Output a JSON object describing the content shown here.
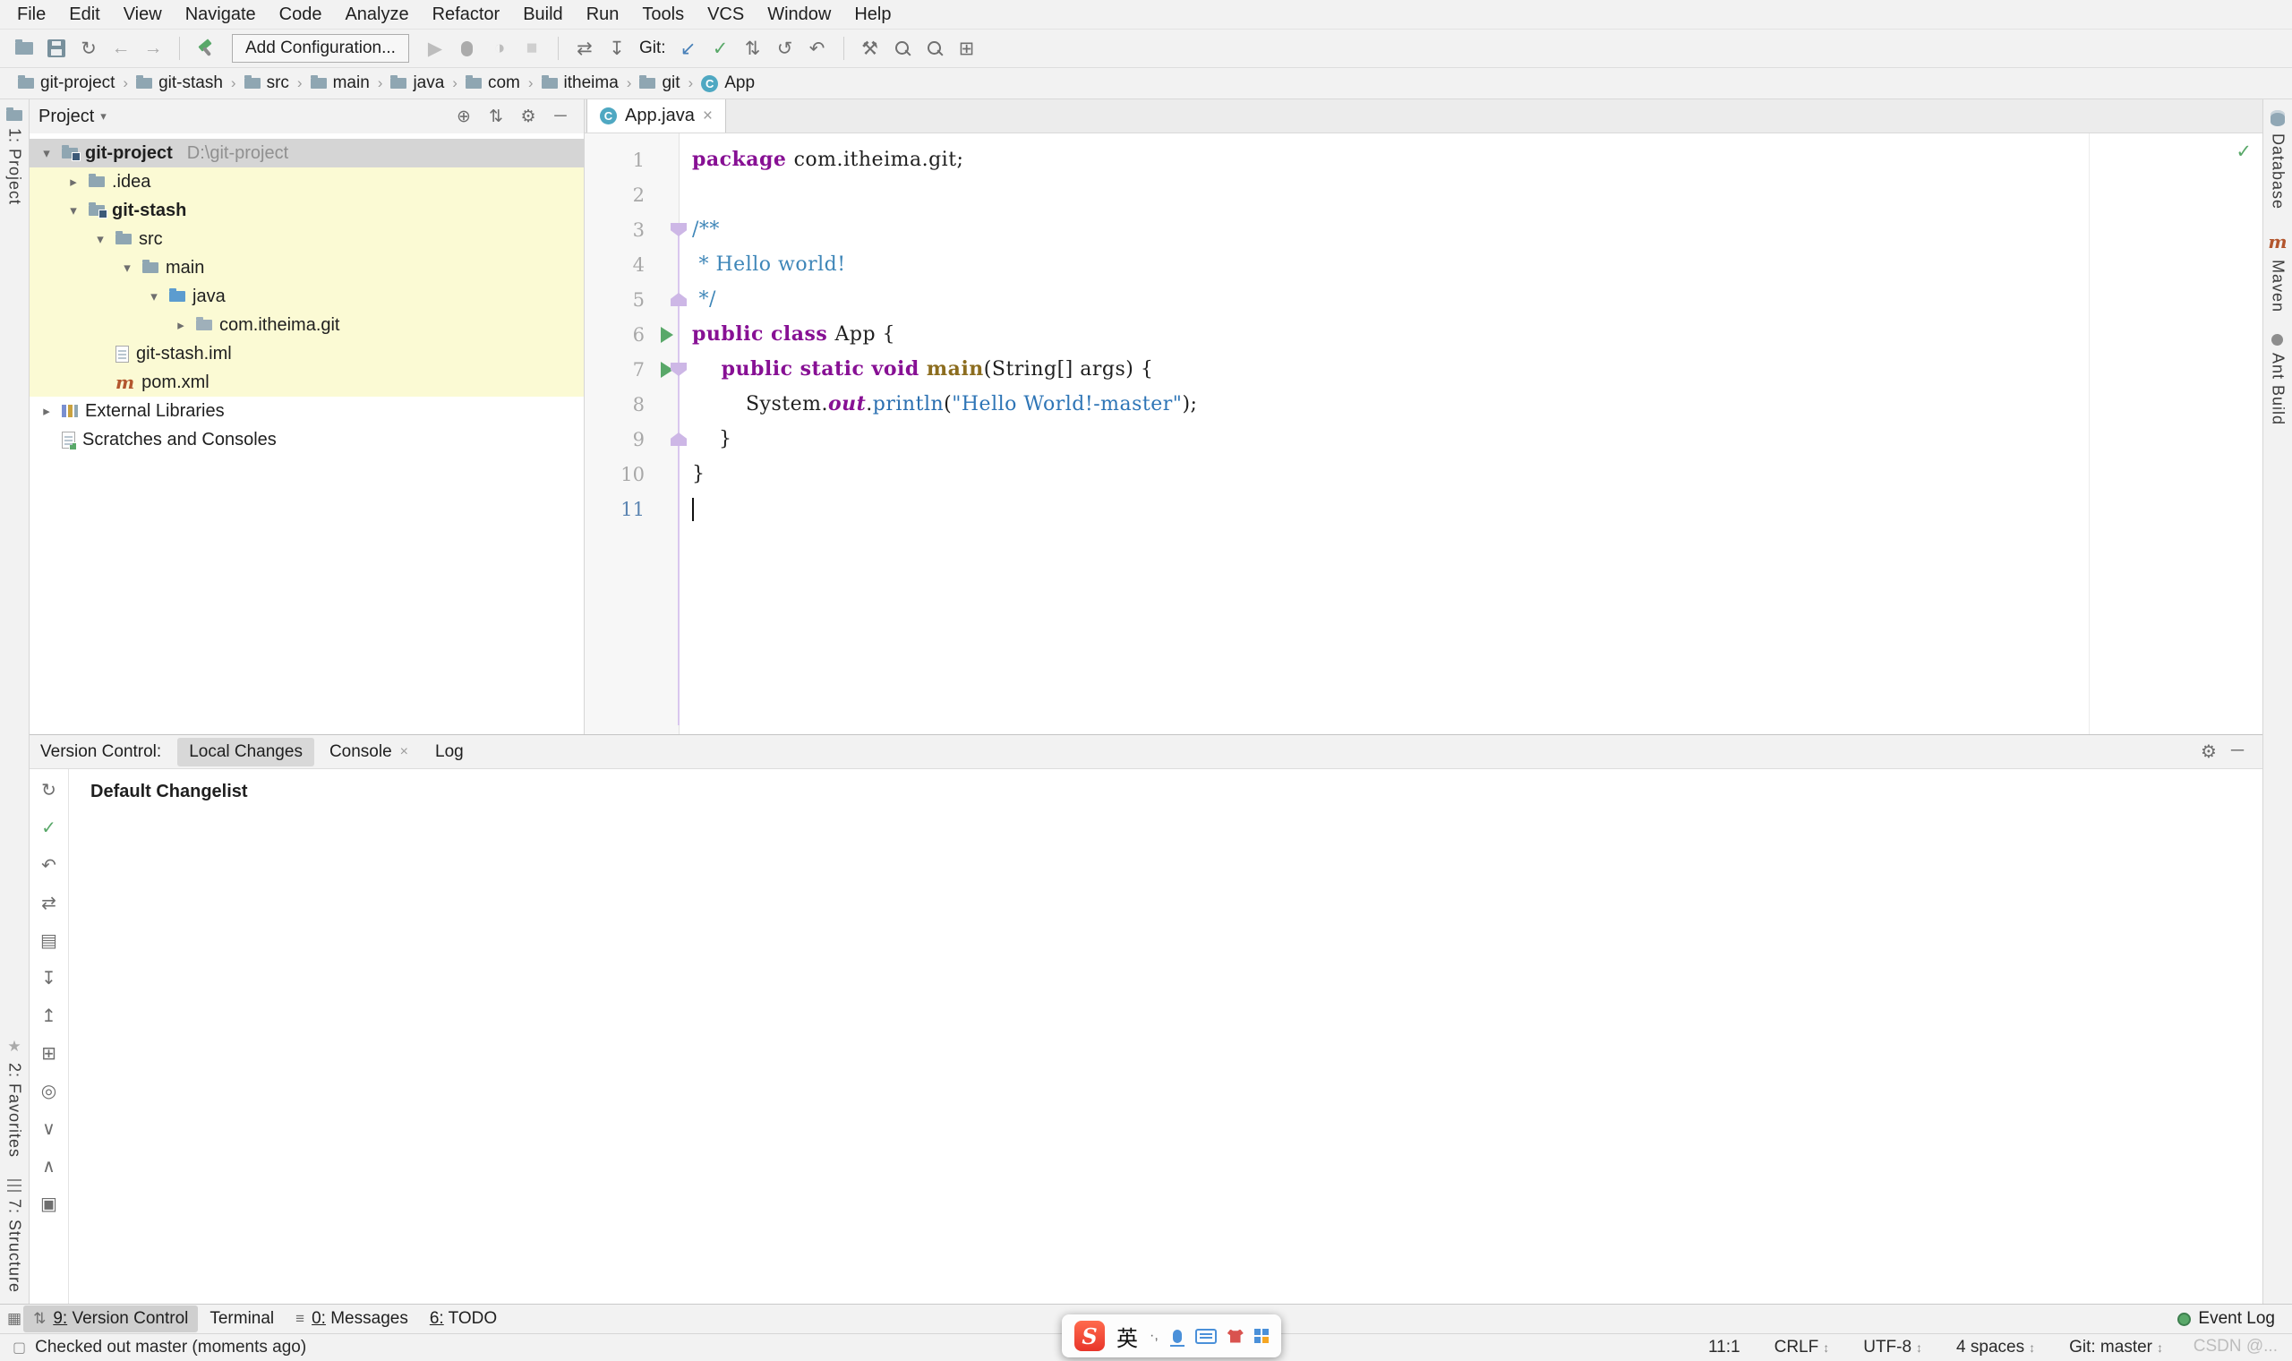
{
  "menubar": {
    "items": [
      "File",
      "Edit",
      "View",
      "Navigate",
      "Code",
      "Analyze",
      "Refactor",
      "Build",
      "Run",
      "Tools",
      "VCS",
      "Window",
      "Help"
    ]
  },
  "toolbar": {
    "items": [
      {
        "type": "css",
        "cls": "icf big",
        "name": "open-icon"
      },
      {
        "type": "css",
        "cls": "ic-floppy",
        "name": "save-all-icon"
      },
      {
        "type": "glyph",
        "g": "↻",
        "name": "synchronize-icon",
        "color": "#707070"
      },
      {
        "type": "glyph",
        "g": "←",
        "name": "back-icon",
        "color": "#ABABAB"
      },
      {
        "type": "glyph",
        "g": "→",
        "name": "forward-icon",
        "color": "#ABABAB"
      },
      {
        "type": "sep"
      },
      {
        "type": "css",
        "cls": "ic-hammer",
        "name": "build-project-icon"
      },
      {
        "type": "combo",
        "name": "run-configurations-combo",
        "label": "Add Configuration..."
      },
      {
        "type": "glyph",
        "g": "▶",
        "name": "run-icon",
        "color": "#BDBDBD"
      },
      {
        "type": "css",
        "cls": "ic-bug",
        "name": "debug-icon"
      },
      {
        "type": "glyph",
        "g": "◑",
        "name": "coverage-icon",
        "color": "#BDBDBD"
      },
      {
        "type": "glyph",
        "g": "■",
        "name": "stop-icon",
        "color": "#CFCFCF"
      },
      {
        "type": "sep"
      },
      {
        "type": "glyph",
        "g": "⇄",
        "name": "compare-icon",
        "color": "#707070"
      },
      {
        "type": "glyph",
        "g": "↧",
        "name": "shelve-icon",
        "color": "#707070"
      },
      {
        "type": "label",
        "text": "Git:",
        "name": "git-label"
      },
      {
        "type": "glyph",
        "g": "↙",
        "name": "vcs-update-icon",
        "color": "#4880B8"
      },
      {
        "type": "glyph",
        "g": "✓",
        "name": "vcs-commit-icon",
        "color": "#59A869"
      },
      {
        "type": "glyph",
        "g": "⇅",
        "name": "vcs-fetch-icon",
        "color": "#707070"
      },
      {
        "type": "glyph",
        "g": "↺",
        "name": "vcs-history-icon",
        "color": "#707070"
      },
      {
        "type": "glyph",
        "g": "↶",
        "name": "vcs-rollback-icon",
        "color": "#707070"
      },
      {
        "type": "sep"
      },
      {
        "type": "glyph",
        "g": "⚒",
        "name": "wrench-icon",
        "color": "#707070"
      },
      {
        "type": "css",
        "cls": "ic-mag",
        "name": "find-in-path-icon"
      },
      {
        "type": "css",
        "cls": "ic-mag",
        "name": "search-everywhere-icon"
      },
      {
        "type": "glyph",
        "g": "⊞",
        "name": "tool-windows-icon",
        "color": "#707070"
      }
    ]
  },
  "breadcrumbs": {
    "items": [
      {
        "label": "git-project",
        "icon": "folder"
      },
      {
        "label": "git-stash",
        "icon": "folder"
      },
      {
        "label": "src",
        "icon": "folder"
      },
      {
        "label": "main",
        "icon": "folder"
      },
      {
        "label": "java",
        "icon": "folder"
      },
      {
        "label": "com",
        "icon": "folder"
      },
      {
        "label": "itheima",
        "icon": "folder"
      },
      {
        "label": "git",
        "icon": "folder"
      },
      {
        "label": "App",
        "icon": "class"
      }
    ]
  },
  "left_stripe": {
    "top": [
      {
        "label": "1: Project",
        "icon": "project"
      }
    ],
    "bottom": [
      {
        "label": "2: Favorites",
        "icon": "star"
      },
      {
        "label": "7: Structure",
        "icon": "structure"
      }
    ]
  },
  "right_stripe": {
    "items": [
      {
        "label": "Database",
        "icon": "database"
      },
      {
        "label": "Maven",
        "icon": "maven"
      },
      {
        "label": "Ant Build",
        "icon": "ant"
      }
    ]
  },
  "project_panel": {
    "title": "Project",
    "header_icons": [
      {
        "g": "⊕",
        "name": "locate-file-icon"
      },
      {
        "g": "⇅",
        "name": "collapse-all-icon"
      },
      {
        "g": "⚙",
        "name": "settings-gear-icon"
      },
      {
        "g": "─",
        "name": "hide-panel-icon"
      }
    ],
    "tree": [
      {
        "label": "git-project",
        "hint": "D:\\git-project",
        "indent": 0,
        "chevron": "down",
        "icon": "project",
        "bold": true,
        "selected": true
      },
      {
        "label": ".idea",
        "indent": 1,
        "chevron": "right",
        "icon": "folder",
        "hl": true
      },
      {
        "label": "git-stash",
        "indent": 1,
        "chevron": "down",
        "icon": "module",
        "bold": true,
        "hl": true
      },
      {
        "label": "src",
        "indent": 2,
        "chevron": "down",
        "icon": "folder",
        "hl": true
      },
      {
        "label": "main",
        "indent": 3,
        "chevron": "down",
        "icon": "folder",
        "hl": true
      },
      {
        "label": "java",
        "indent": 4,
        "chevron": "down",
        "icon": "source-folder",
        "hl": true
      },
      {
        "label": "com.itheima.git",
        "indent": 5,
        "chevron": "right",
        "icon": "package",
        "hl": true
      },
      {
        "label": "git-stash.iml",
        "indent": 2,
        "chevron": "none",
        "icon": "file",
        "hl": true
      },
      {
        "label": "pom.xml",
        "indent": 2,
        "chevron": "none",
        "icon": "maven-file",
        "hl": true
      },
      {
        "label": "External Libraries",
        "indent": 0,
        "chevron": "right",
        "icon": "libraries"
      },
      {
        "label": "Scratches and Consoles",
        "indent": 0,
        "chevron": "none",
        "icon": "scratches"
      }
    ]
  },
  "editor": {
    "tab": {
      "label": "App.java",
      "icon": "class"
    },
    "inspection_status": "ok",
    "lines": [
      {
        "n": 1,
        "tokens": [
          [
            "k",
            "package "
          ],
          [
            "p",
            "com.itheima.git;"
          ]
        ]
      },
      {
        "n": 2,
        "tokens": []
      },
      {
        "n": 3,
        "tokens": [
          [
            "c",
            "/**"
          ]
        ],
        "marks": [
          "fold-down"
        ]
      },
      {
        "n": 4,
        "tokens": [
          [
            "c",
            " * Hello world!"
          ]
        ]
      },
      {
        "n": 5,
        "tokens": [
          [
            "c",
            " */"
          ]
        ],
        "marks": [
          "fold-up"
        ]
      },
      {
        "n": 6,
        "tokens": [
          [
            "k",
            "public class "
          ],
          [
            "p",
            "App {"
          ]
        ],
        "marks": [
          "run"
        ]
      },
      {
        "n": 7,
        "tokens": [
          [
            "k",
            "    public static void "
          ],
          [
            "d",
            "main"
          ],
          [
            "p",
            "(String[] args) {"
          ]
        ],
        "marks": [
          "run",
          "fold-down"
        ]
      },
      {
        "n": 8,
        "tokens": [
          [
            "p",
            "        System."
          ],
          [
            "f",
            "out"
          ],
          [
            "p",
            "."
          ],
          [
            "m",
            "println"
          ],
          [
            "p",
            "("
          ],
          [
            "s",
            "\"Hello World!-master\""
          ],
          [
            "p",
            ");"
          ]
        ]
      },
      {
        "n": 9,
        "tokens": [
          [
            "p",
            "    }"
          ]
        ],
        "marks": [
          "fold-up"
        ]
      },
      {
        "n": 10,
        "tokens": [
          [
            "p",
            "}"
          ]
        ]
      },
      {
        "n": 11,
        "tokens": [],
        "caret": true
      }
    ]
  },
  "version_control": {
    "label": "Version Control:",
    "tabs": [
      {
        "label": "Local Changes",
        "active": true
      },
      {
        "label": "Console",
        "closable": true
      },
      {
        "label": "Log"
      }
    ],
    "header_icons": [
      {
        "g": "⚙",
        "name": "settings-gear-icon"
      },
      {
        "g": "─",
        "name": "hide-panel-icon"
      }
    ],
    "toolbar_icons": [
      {
        "g": "↻",
        "name": "refresh-icon",
        "color": "#6E6E6E"
      },
      {
        "g": "✓",
        "name": "commit-icon",
        "color": "#59A869"
      },
      {
        "g": "↶",
        "name": "rollback-icon",
        "color": "#6E6E6E"
      },
      {
        "g": "⇄",
        "name": "diff-icon",
        "color": "#6E6E6E"
      },
      {
        "g": "▤",
        "name": "changelist-icon",
        "color": "#6E6E6E"
      },
      {
        "g": "↧",
        "name": "shelve-icon",
        "color": "#6E6E6E"
      },
      {
        "g": "↥",
        "name": "unshelve-icon",
        "color": "#6E6E6E"
      },
      {
        "g": "⊞",
        "name": "group-by-icon",
        "color": "#6E6E6E"
      },
      {
        "g": "◎",
        "name": "preview-diff-icon",
        "color": "#6E6E6E"
      },
      {
        "g": "∨",
        "name": "expand-all-icon",
        "color": "#6E6E6E"
      },
      {
        "g": "∧",
        "name": "collapse-all-icon",
        "color": "#6E6E6E"
      },
      {
        "g": "▣",
        "name": "details-view-icon",
        "color": "#6E6E6E"
      }
    ],
    "content_title": "Default Changelist"
  },
  "toolwindow_bar": {
    "switcher_icon": "▦",
    "left": [
      {
        "label": "9: Version Control",
        "active": true,
        "icon": "⇅",
        "mnemonic": true
      },
      {
        "label": "Terminal"
      },
      {
        "label": "0: Messages",
        "icon": "≡",
        "mnemonic": true
      },
      {
        "label": "6: TODO",
        "mnemonic": true
      }
    ],
    "right": [
      {
        "label": "Event Log",
        "icon": "event"
      }
    ]
  },
  "statusbar": {
    "message": "Checked out master (moments ago)",
    "segments": [
      {
        "label": "11:1",
        "arrows": false
      },
      {
        "label": "CRLF",
        "arrows": true
      },
      {
        "label": "UTF-8",
        "arrows": true
      },
      {
        "label": "4 spaces",
        "arrows": true
      },
      {
        "label": "Git: master",
        "arrows": true
      }
    ]
  },
  "ime": {
    "logo": "S",
    "lang": "英",
    "punct": "·,",
    "icons": [
      "mic",
      "keyboard",
      "skin",
      "toolbox"
    ]
  },
  "watermark": "CSDN @..."
}
